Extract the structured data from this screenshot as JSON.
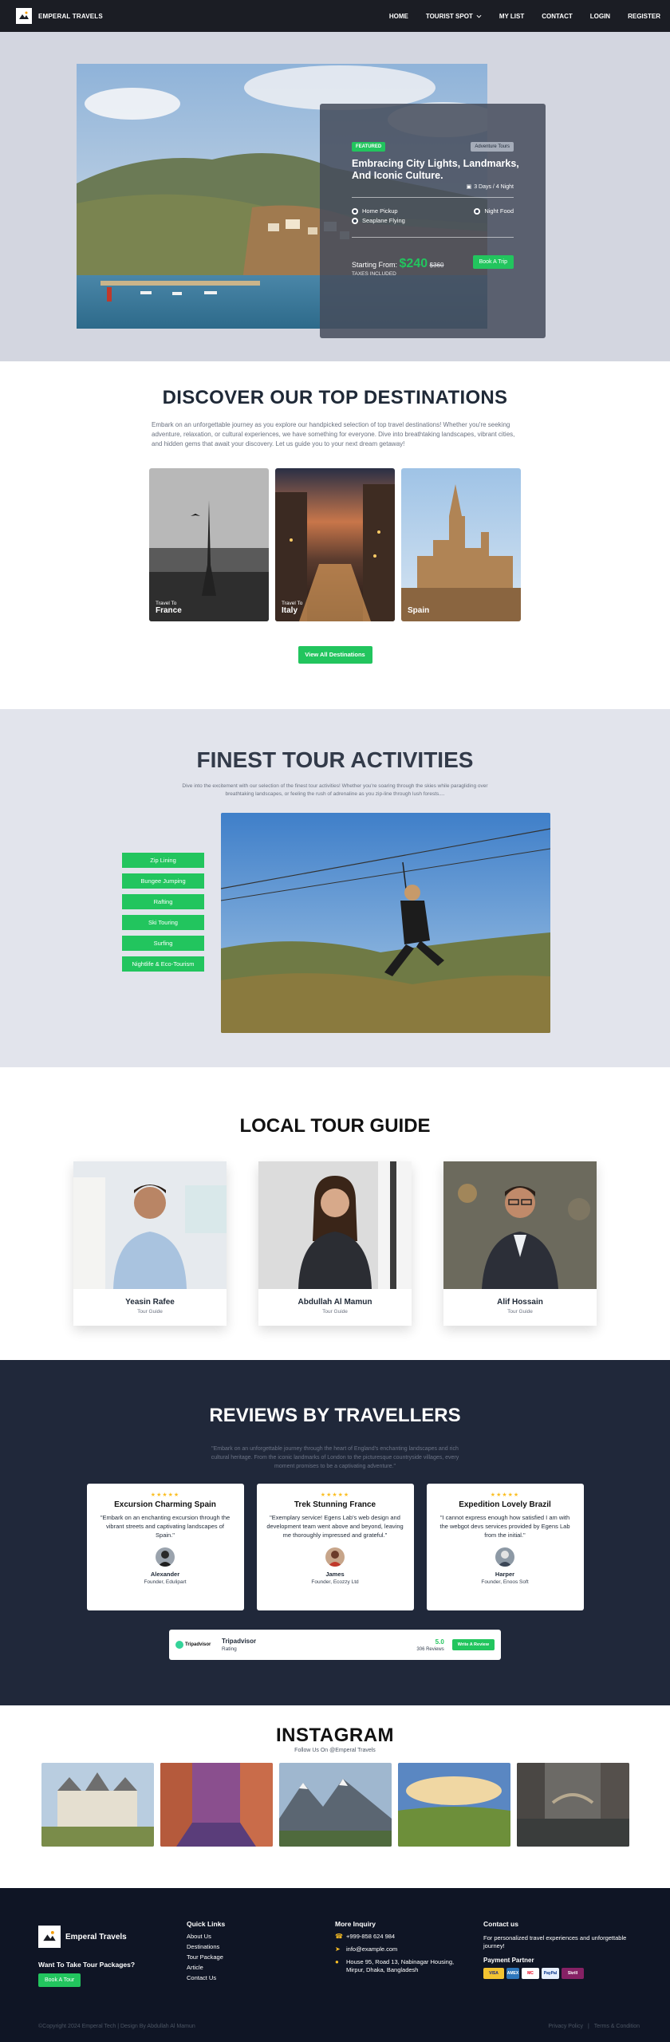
{
  "nav": {
    "brand": "EMPERAL TRAVELS",
    "links": [
      "HOME",
      "TOURIST SPOT",
      "MY LIST",
      "CONTACT",
      "LOGIN",
      "REGISTER"
    ]
  },
  "hero": {
    "badge_featured": "FEATURED",
    "badge_category": "Adventure Tours",
    "title": "Embracing City Lights, Landmarks, And Iconic Culture.",
    "duration": "3 Days / 4 Night",
    "features": [
      "Home Pickup",
      "Night Food",
      "Seaplane Flying"
    ],
    "price_label": "Starting From:",
    "price": "$240",
    "old_price": "$360",
    "taxes": "TAXES INCLUDED",
    "book_button": "Book A Trip"
  },
  "discover": {
    "heading": "DISCOVER OUR TOP DESTINATIONS",
    "paragraph": "Embark on an unforgettable journey as you explore our handpicked selection of top travel destinations! Whether you're seeking adventure, relaxation, or cultural experiences, we have something for everyone. Dive into breathtaking landscapes, vibrant cities, and hidden gems that await your discovery. Let us guide you to your next dream getaway!",
    "cards": [
      {
        "sub": "Travel To",
        "name": "France"
      },
      {
        "sub": "Travel To",
        "name": "Italy"
      },
      {
        "sub": "",
        "name": "Spain"
      }
    ],
    "button": "View All Destinations"
  },
  "activities": {
    "heading": "FINEST TOUR ACTIVITIES",
    "paragraph": "Dive into the excitement with our selection of the finest tour activities! Whether you're soaring through the skies while paragliding over breathtaking landscapes, or feeling the rush of adrenaline as you zip-line through lush forests....",
    "items": [
      "Zip Lining",
      "Bungee Jumping",
      "Rafting",
      "Ski Touring",
      "Surfing",
      "Nightlife & Eco-Tourism"
    ]
  },
  "guide": {
    "heading": "LOCAL TOUR GUIDE",
    "guides": [
      {
        "name": "Yeasin Rafee",
        "role": "Tour Guide"
      },
      {
        "name": "Abdullah Al Mamun",
        "role": "Tour Guide"
      },
      {
        "name": "Alif Hossain",
        "role": "Tour Guide"
      }
    ]
  },
  "reviews": {
    "heading": "REVIEWS BY TRAVELLERS",
    "paragraph": "\"Embark on an unforgettable journey through the heart of England's enchanting landscapes and rich cultural heritage. From the iconic landmarks of London to the picturesque countryside villages, every moment promises to be a captivating adventure.\"",
    "stars": "★★★★★",
    "cards": [
      {
        "title": "Excursion Charming Spain",
        "text": "\"Embark on an enchanting excursion through the vibrant streets and captivating landscapes of Spain.\"",
        "name": "Alexander",
        "role": "Founder, Edulipart"
      },
      {
        "title": "Trek Stunning France",
        "text": "\"Exemplary service! Egens Lab's web design and development team went above and beyond, leaving me thoroughly impressed and grateful.\"",
        "name": "James",
        "role": "Founder, Ecozzy Ltd"
      },
      {
        "title": "Expedition Lovely Brazil",
        "text": "\"I cannot express enough how satisfied I am with the webgot devs services provided by Egens Lab from the initial.\"",
        "name": "Harper",
        "role": "Founder, Enoos Soft"
      }
    ],
    "tripadvisor": {
      "logo": "Tripadvisor",
      "name": "Tripadvisor",
      "sub": "Rating",
      "score": "5.0",
      "count": "306 Reviews",
      "button": "Write A Review"
    }
  },
  "instagram": {
    "heading": "INSTAGRAM",
    "sub": "Follow Us On @Emperal Travels"
  },
  "footer": {
    "brand": "Emperal Travels",
    "want": "Want To Take Tour Packages?",
    "book": "Book A Tour",
    "quick_title": "Quick Links",
    "quick_links": [
      "About Us",
      "Destinations",
      "Tour Package",
      "Article",
      "Contact Us"
    ],
    "inquiry_title": "More Inquiry",
    "phone": "+999-858 624 984",
    "email": "info@example.com",
    "address": "House 95, Road 13, Nabinagar Housing, Mirpur, Dhaka, Bangladesh",
    "contact_title": "Contact us",
    "contact_text": "For personalized travel experiences and unforgettable journey!",
    "payment_title": "Payment Partner",
    "payments": [
      "VISA",
      "AMEX",
      "MC",
      "PayPal",
      "Skrill"
    ],
    "copyright": "©Copyright 2024 Emperal Tech | Design By Abdullah Al Mamun",
    "privacy": "Privacy Policy",
    "terms": "Terms & Condition"
  },
  "colors": {
    "accent_green": "#22c55e",
    "nav_bg": "#1b1d24",
    "reviews_bg": "#20283a",
    "footer_bg": "#0f1525",
    "star": "#fbbf24"
  }
}
